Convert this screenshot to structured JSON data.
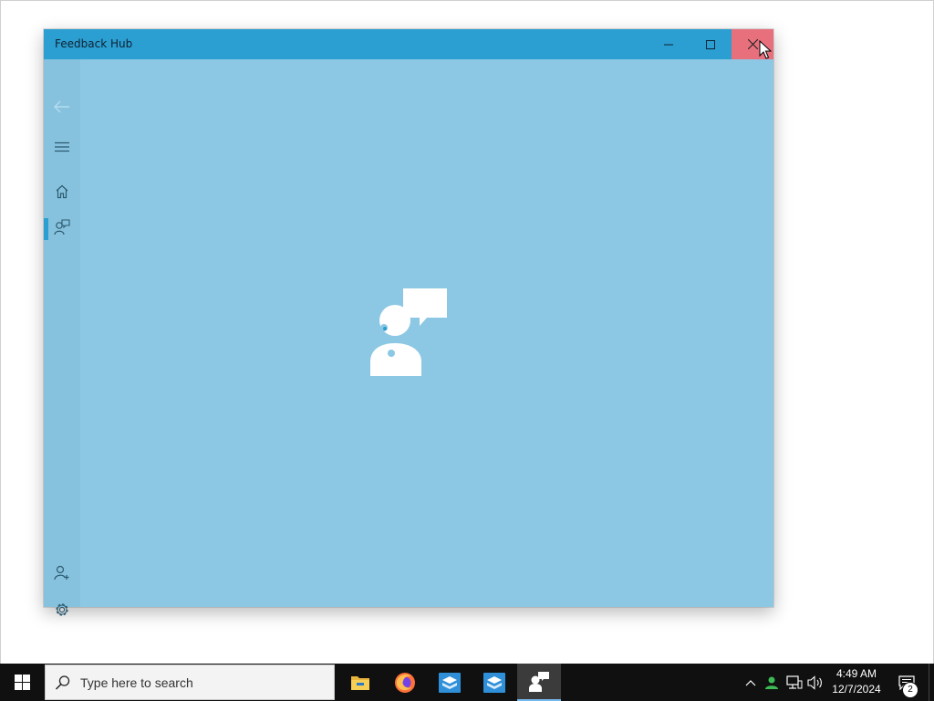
{
  "window": {
    "title": "Feedback Hub",
    "titlebar_color": "#2b9ed2",
    "content_color": "#8cc8e4",
    "close_hover_color": "#e8707d"
  },
  "nav": {
    "items": [
      {
        "icon": "back-arrow-icon"
      },
      {
        "icon": "hamburger-menu-icon"
      },
      {
        "icon": "home-icon"
      },
      {
        "icon": "feedback-icon",
        "active": true
      },
      {
        "icon": "add-person-icon"
      },
      {
        "icon": "gear-icon"
      }
    ]
  },
  "splash": {
    "icon": "feedback-hub-logo-icon"
  },
  "taskbar": {
    "search_placeholder": "Type here to search",
    "apps": [
      "file-explorer-icon",
      "firefox-icon",
      "sandbox-icon",
      "sandbox-icon-2",
      "feedback-hub-icon"
    ],
    "active_app": "feedback-hub-icon",
    "clock": {
      "time": "4:49 AM",
      "date": "12/7/2024"
    },
    "notification_count": "2"
  }
}
